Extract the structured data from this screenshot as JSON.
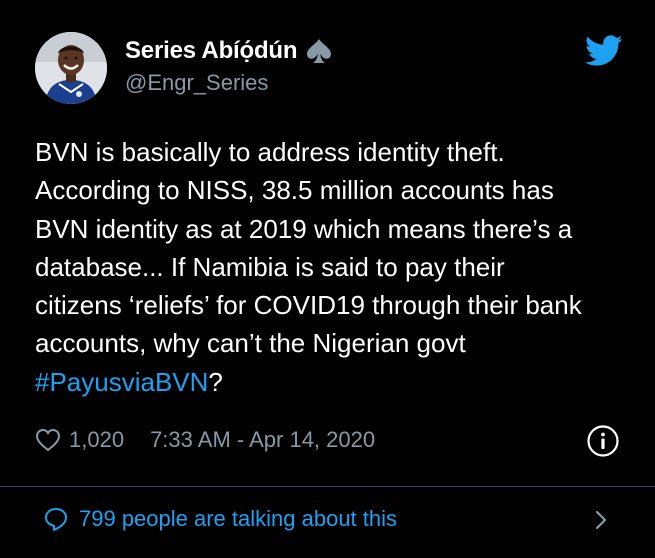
{
  "author": {
    "display_name": "Series Abíọ́dún",
    "handle": "@Engr_Series",
    "badge_icon": "spade-icon"
  },
  "tweet": {
    "text_prefix": "BVN is basically to address identity theft.\nAccording to NISS, 38.5 million accounts has\nBVN identity as at 2019 which means there’s a\ndatabase... If Namibia is said to pay their\ncitizens ‘reliefs’ for COVID19 through their bank\naccounts, why can’t the Nigerian govt\n",
    "hashtag": "#PayusviaBVN",
    "text_suffix": "?"
  },
  "meta": {
    "like_count": "1,020",
    "timestamp": "7:33 AM - Apr 14, 2020"
  },
  "footer": {
    "talking_label": "799 people are talking about this"
  },
  "colors": {
    "background": "#000000",
    "text": "#ffffff",
    "secondary": "#8899a6",
    "accent": "#1da1f2",
    "divider": "#38444d"
  },
  "icons": {
    "brand": "twitter-bird-icon",
    "like": "heart-icon",
    "info": "info-icon",
    "comment": "comment-icon",
    "chevron": "chevron-right-icon"
  }
}
